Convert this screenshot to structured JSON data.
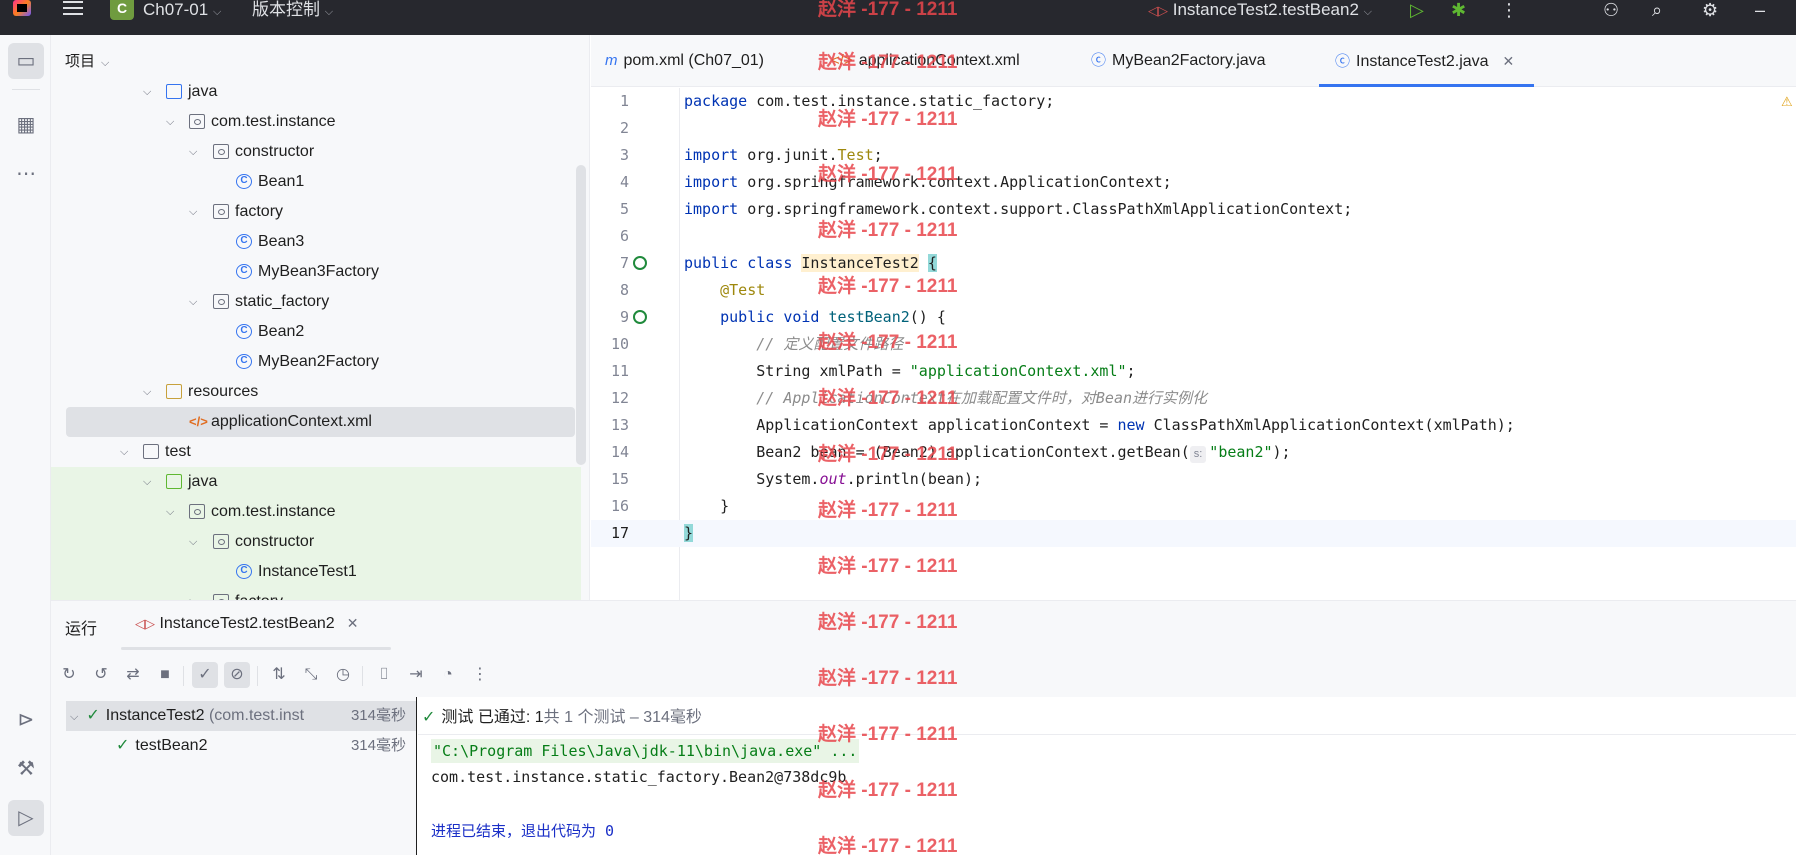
{
  "titlebar": {
    "project": "Ch07-01",
    "project_initial": "C",
    "vcs": "版本控制",
    "run_config": "InstanceTest2.testBean2"
  },
  "project_panel": {
    "title": "项目",
    "items": [
      {
        "label": "java",
        "type": "folder",
        "level": 0
      },
      {
        "label": "com.test.instance",
        "type": "package",
        "level": 1
      },
      {
        "label": "constructor",
        "type": "package",
        "level": 2
      },
      {
        "label": "Bean1",
        "type": "class",
        "level": 3
      },
      {
        "label": "factory",
        "type": "package",
        "level": 2
      },
      {
        "label": "Bean3",
        "type": "class",
        "level": 3
      },
      {
        "label": "MyBean3Factory",
        "type": "class",
        "level": 3
      },
      {
        "label": "static_factory",
        "type": "package",
        "level": 2
      },
      {
        "label": "Bean2",
        "type": "class",
        "level": 3
      },
      {
        "label": "MyBean2Factory",
        "type": "class",
        "level": 3
      },
      {
        "label": "resources",
        "type": "folder",
        "level": 0
      },
      {
        "label": "applicationContext.xml",
        "type": "xml",
        "level": 1
      },
      {
        "label": "test",
        "type": "folder",
        "level": -1
      },
      {
        "label": "java",
        "type": "folder",
        "level": 0
      },
      {
        "label": "com.test.instance",
        "type": "package",
        "level": 1
      },
      {
        "label": "constructor",
        "type": "package",
        "level": 2
      },
      {
        "label": "InstanceTest1",
        "type": "class",
        "level": 3
      },
      {
        "label": "factory",
        "type": "package",
        "level": 2
      }
    ]
  },
  "editor": {
    "tabs": [
      {
        "label": "pom.xml (Ch07_01)",
        "icon": "m"
      },
      {
        "label": "applicationContext.xml",
        "icon": "xml-icon"
      },
      {
        "label": "MyBean2Factory.java",
        "icon": "class-icon"
      },
      {
        "label": "InstanceTest2.java",
        "icon": "class-icon"
      }
    ],
    "line_numbers": [
      "1",
      "2",
      "3",
      "4",
      "5",
      "6",
      "7",
      "8",
      "9",
      "10",
      "11",
      "12",
      "13",
      "14",
      "15",
      "16",
      "17"
    ],
    "code": {
      "l1_kw": "package",
      "l1_rest": " com.test.instance.static_factory;",
      "l3_kw": "import",
      "l3_rest": " org.junit.",
      "l3_ann": "Test",
      "l3_end": ";",
      "l4_kw": "import",
      "l4_rest": " org.springframework.context.ApplicationContext;",
      "l5_kw": "import",
      "l5_rest": " org.springframework.context.support.ClassPathXmlApplicationContext;",
      "l7_kw": "public class",
      "l7_cls": "InstanceTest2",
      "l7_brace": "{",
      "l8_ann": "@Test",
      "l9_kw": "public void",
      "l9_fn": "testBean2",
      "l9_rest": "() {",
      "l10_cmt": "// 定义配置文件路径",
      "l11_pre": "String xmlPath = ",
      "l11_str": "\"applicationContext.xml\"",
      "l11_end": ";",
      "l12_cmt": "// ApplicationContext在加载配置文件时，对Bean进行实例化",
      "l13_pre": "ApplicationContext applicationContext = ",
      "l13_kw": "new",
      "l13_rest": " ClassPathXmlApplicationContext(xmlPath);",
      "l14_pre": "Bean2 bean = (Bean2) applicationContext.getBean(",
      "l14_hint": "s:",
      "l14_str": "\"bean2\"",
      "l14_end": ");",
      "l15_pre": "System.",
      "l15_fld": "out",
      "l15_rest": ".println(bean);",
      "l16": "}",
      "l17": "}"
    }
  },
  "run": {
    "label": "运行",
    "tab": "InstanceTest2.testBean2",
    "tests": [
      {
        "name": "InstanceTest2",
        "detail": "(com.test.inst",
        "duration": "314毫秒"
      },
      {
        "name": "testBean2",
        "duration": "314毫秒"
      }
    ],
    "status_prefix": "测试 已通过: 1",
    "status_suffix": "共 1 个测试 – 314毫秒",
    "console": {
      "cmd": "\"C:\\Program Files\\Java\\jdk-11\\bin\\java.exe\" ...",
      "output": "com.test.instance.static_factory.Bean2@738dc9b",
      "exit": "进程已结束，退出代码为 0"
    }
  },
  "watermark": "赵洋 -177 - 1211",
  "colors": {
    "accent": "#3574f0",
    "pass": "#208a3c",
    "watermark": "#e8464c"
  }
}
